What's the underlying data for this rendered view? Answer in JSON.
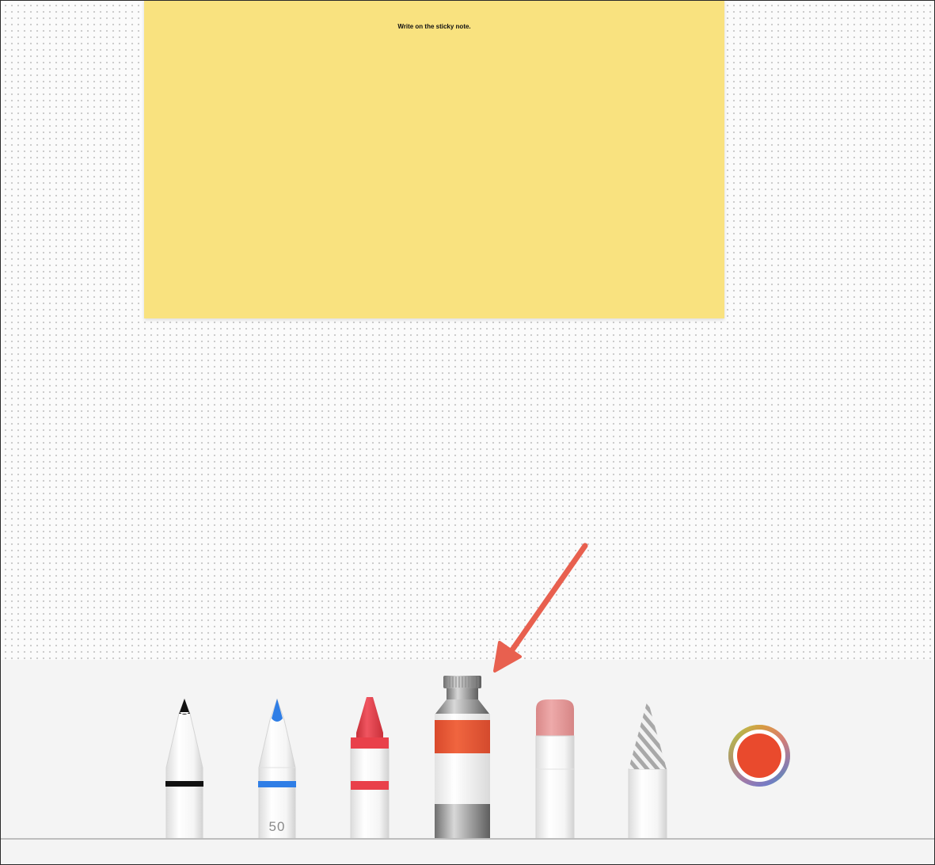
{
  "sticky_note": {
    "text": "Write on the sticky note.",
    "color": "#f9e27f"
  },
  "tools": {
    "pen": {
      "name": "pen",
      "ink_color": "#111111"
    },
    "marker": {
      "name": "marker",
      "ink_color": "#2f7ee6",
      "width_label": "50"
    },
    "crayon": {
      "name": "crayon",
      "ink_color": "#e9404a"
    },
    "watercolor": {
      "name": "watercolor",
      "ink_color": "#ef5f3c"
    },
    "eraser": {
      "name": "eraser",
      "tip_color": "#e9a0a0"
    },
    "lasso": {
      "name": "lasso"
    },
    "color_picker": {
      "name": "color picker",
      "selected_color": "#e94a2d"
    }
  },
  "annotation": {
    "arrow_color": "#e8604f",
    "points_to": "watercolor"
  },
  "colors": {
    "panel": "#f4f4f4",
    "canvas": "#fbfbfb"
  }
}
